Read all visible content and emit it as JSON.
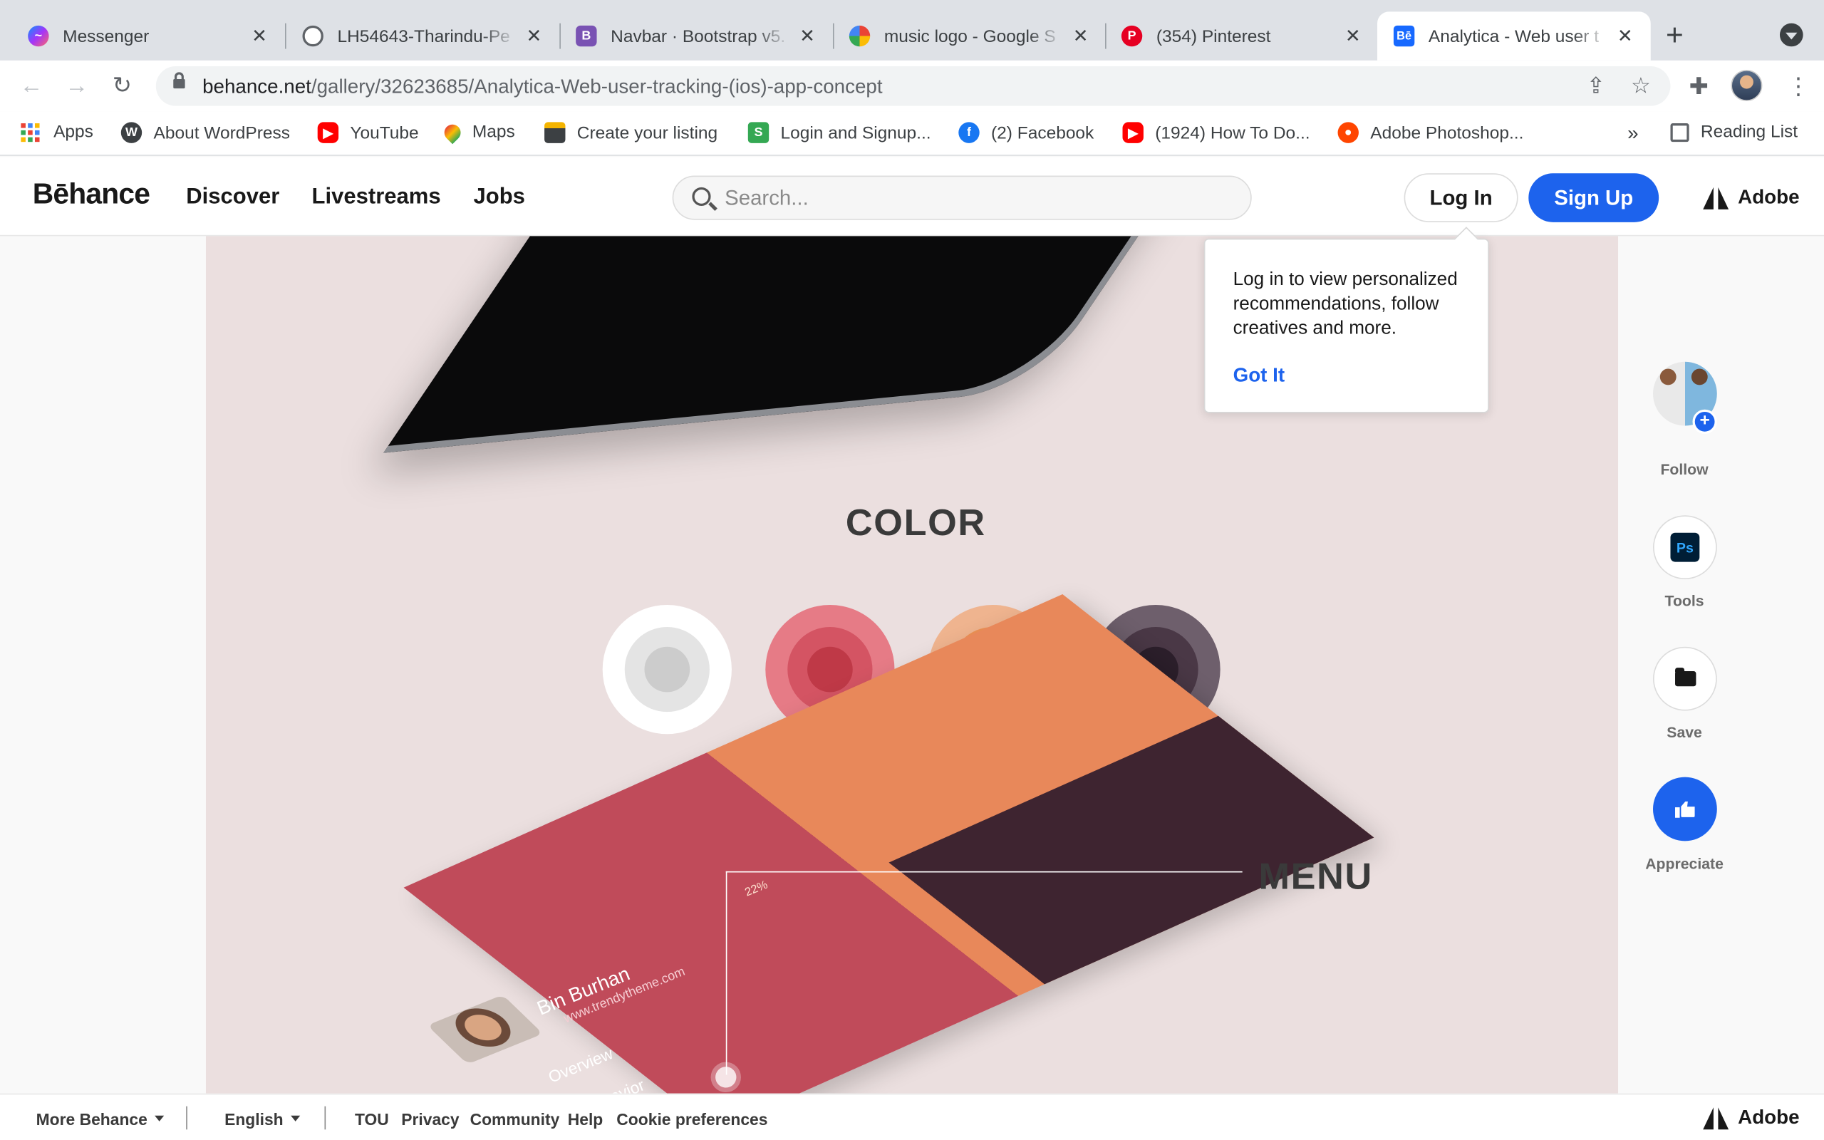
{
  "browser": {
    "tabs": [
      {
        "title": "Messenger",
        "icon": "messenger-icon",
        "color": "#a033ff"
      },
      {
        "title": "LH54643-Tharindu-Pe",
        "icon": "globe-icon",
        "color": "#5f6368"
      },
      {
        "title": "Navbar · Bootstrap v5.",
        "icon": "bootstrap-icon",
        "color": "#7952b3"
      },
      {
        "title": "music logo - Google S",
        "icon": "google-icon",
        "color": "#4285f4"
      },
      {
        "title": "(354) Pinterest",
        "icon": "pinterest-icon",
        "color": "#e60023"
      },
      {
        "title": "Analytica - Web user t",
        "icon": "behance-icon",
        "color": "#1769ff",
        "active": true
      }
    ],
    "new_tab": "+",
    "url_host": "behance.net",
    "url_path": "/gallery/32623685/Analytica-Web-user-tracking-(ios)-app-concept",
    "bookmarks": [
      {
        "label": "Apps",
        "icon": "apps-grid-icon"
      },
      {
        "label": "About WordPress",
        "icon": "wordpress-icon"
      },
      {
        "label": "YouTube",
        "icon": "youtube-icon"
      },
      {
        "label": "Maps",
        "icon": "maps-pin-icon"
      },
      {
        "label": "Create your listing",
        "icon": "listing-icon"
      },
      {
        "label": "Login and Signup...",
        "icon": "signup-s-icon"
      },
      {
        "label": "(2) Facebook",
        "icon": "facebook-icon"
      },
      {
        "label": "(1924) How To Do...",
        "icon": "youtube-icon"
      },
      {
        "label": "Adobe Photoshop...",
        "icon": "reddit-icon"
      }
    ],
    "bookmarks_overflow": "»",
    "reading_list": "Reading List"
  },
  "behance": {
    "logo": "Bēhance",
    "nav": [
      "Discover",
      "Livestreams",
      "Jobs"
    ],
    "search_placeholder": "Search...",
    "login": "Log In",
    "signup": "Sign Up",
    "adobe": "Adobe"
  },
  "popover": {
    "text": "Log in to view personalized recommendations, follow creatives and more.",
    "action": "Got It"
  },
  "content": {
    "color_title": "COLOR",
    "menu_title": "MENU",
    "swatches": [
      {
        "outer": "#ffffff",
        "mid": "#e4e4e4",
        "core": "#cccccc"
      },
      {
        "outer": "#e67b86",
        "mid": "#d45463",
        "core": "#bf3947"
      },
      {
        "outer": "#efb48f",
        "mid": "#ee9155",
        "core": "#e0704a"
      },
      {
        "outer": "#6e5f6c",
        "mid": "#4a3846",
        "core": "#2c1f2b"
      }
    ],
    "card_name": "Bin Burhan",
    "card_site": "www.trendytheme.com",
    "card_items": [
      "Overview",
      "Behavior"
    ],
    "card_status": "22%"
  },
  "rail": {
    "follow": "Follow",
    "tools": "Tools",
    "tools_badge": "Ps",
    "save": "Save",
    "appreciate": "Appreciate"
  },
  "footer": {
    "more": "More Behance",
    "language": "English",
    "links": [
      "TOU",
      "Privacy",
      "Community",
      "Help",
      "Cookie preferences"
    ],
    "adobe": "Adobe"
  },
  "colors": {
    "accent": "#1d63ed",
    "canvas": "#ebdfdf"
  }
}
